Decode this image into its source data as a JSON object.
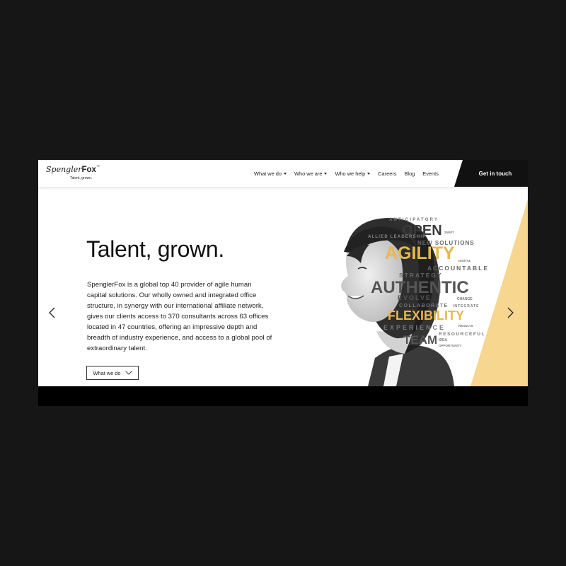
{
  "header": {
    "logo": {
      "part1": "Spengler",
      "part2": "Fox",
      "tm": "™",
      "tagline": "Talent, grown."
    },
    "nav": [
      {
        "label": "What we do",
        "dropdown": true
      },
      {
        "label": "Who we are",
        "dropdown": true
      },
      {
        "label": "Who we help",
        "dropdown": true
      },
      {
        "label": "Careers",
        "dropdown": false
      },
      {
        "label": "Blog",
        "dropdown": false
      },
      {
        "label": "Events",
        "dropdown": false
      }
    ],
    "cta_label": "Get in touch"
  },
  "hero": {
    "heading": "Talent, grown.",
    "body": "SpenglerFox is a global top 40 provider of agile human capital solutions. Our wholly owned and integrated office structure, in synergy with our international affiliate network, gives our clients access to 370 consultants across 63 offices located in 47 countries, offering an impressive depth and breadth of industry experience, and access to a global pool of extraordinary talent.",
    "button_label": "What we do",
    "word_cloud": [
      "ANTICIPATORY",
      "OPEN",
      "ALLIED LEADERSHIP",
      "SWIFT",
      "NEW SOLUTIONS",
      "AGILITY",
      "DIGITAL",
      "ACCOUNTABLE",
      "STRATEGY",
      "AUTHENTIC",
      "EVOLVE",
      "CHANGE",
      "COLLABORATE",
      "INTEGRATE",
      "FLEXIBILITY",
      "EXPERIENCE",
      "RESULTS",
      "TEAM",
      "RESOURCEFUL",
      "IDEA",
      "OPPORTUNITY"
    ]
  },
  "colors": {
    "accent_yellow": "#f7d68f",
    "cta_bg": "#111111",
    "page_bg": "#161616",
    "word_gold": "#e7b94c"
  }
}
